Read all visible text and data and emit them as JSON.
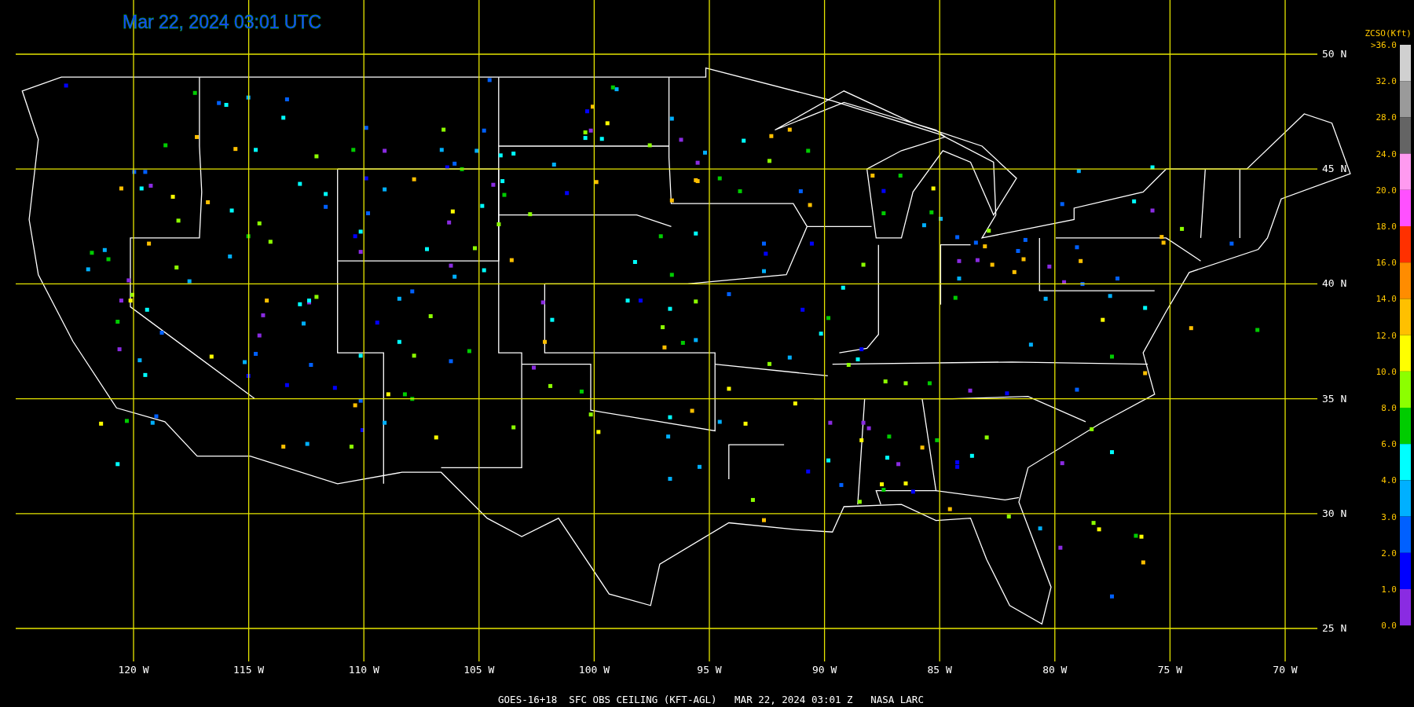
{
  "title": "Mar 22, 2024 03:01 UTC",
  "latitude_labels": [
    "50 N",
    "45 N",
    "40 N",
    "35 N",
    "30 N",
    "25 N"
  ],
  "longitude_labels": [
    "120 W",
    "115 W",
    "110 W",
    "105 W",
    "100 W",
    "95 W",
    "90 W",
    "85 W",
    "80 W",
    "75 W",
    "70 W"
  ],
  "legend": {
    "title": "ZCSO(Kft)",
    "ticks": [
      ">36.0",
      "32.0",
      "28.0",
      "24.0",
      "20.0",
      "18.0",
      "16.0",
      "14.0",
      "12.0",
      "10.0",
      "8.0",
      "6.0",
      "4.0",
      "3.0",
      "2.0",
      "1.0",
      "0.0"
    ],
    "bins": [
      {
        "color": "#d0d0d0"
      },
      {
        "color": "#9a9a9a"
      },
      {
        "color": "#646464"
      },
      {
        "color": "#ff9af0"
      },
      {
        "color": "#ff50ff"
      },
      {
        "color": "#ff3000"
      },
      {
        "color": "#ff8c00"
      },
      {
        "color": "#ffc000"
      },
      {
        "color": "#ffff00"
      },
      {
        "color": "#8cff00"
      },
      {
        "color": "#00cc00"
      },
      {
        "color": "#00ffff"
      },
      {
        "color": "#00b0ff"
      },
      {
        "color": "#0060ff"
      },
      {
        "color": "#0000ff"
      },
      {
        "color": "#8a2be2"
      }
    ]
  },
  "caption": "GOES-16+18  SFC OBS CEILING (KFT-AGL)   MAR 22, 2024 03:01 Z   NASA LARC"
}
